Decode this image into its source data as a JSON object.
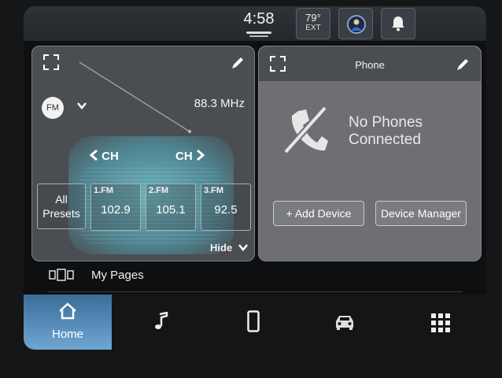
{
  "status": {
    "clock": "4:58",
    "temp_value": "79°",
    "temp_label": "EXT"
  },
  "radio": {
    "band": "FM",
    "frequency": "88.3 MHz",
    "ch_prev": "CH",
    "ch_next": "CH",
    "all_presets": "All Presets",
    "presets": [
      {
        "num": "1.FM",
        "value": "102.9"
      },
      {
        "num": "2.FM",
        "value": "105.1"
      },
      {
        "num": "3.FM",
        "value": "92.5"
      }
    ],
    "hide": "Hide"
  },
  "phone": {
    "title": "Phone",
    "status_line1": "No Phones",
    "status_line2": "Connected",
    "add_device": "+ Add Device",
    "device_manager": "Device Manager"
  },
  "my_pages": "My Pages",
  "nav": {
    "home": "Home"
  },
  "icons": [
    "expand-icon",
    "pencil-icon",
    "chevron-down-icon",
    "chevron-left-icon",
    "chevron-right-icon",
    "no-phone-icon",
    "pages-icon",
    "home-icon",
    "music-icon",
    "phone-icon",
    "car-icon",
    "grid-icon",
    "bell-icon",
    "driver-icon"
  ]
}
